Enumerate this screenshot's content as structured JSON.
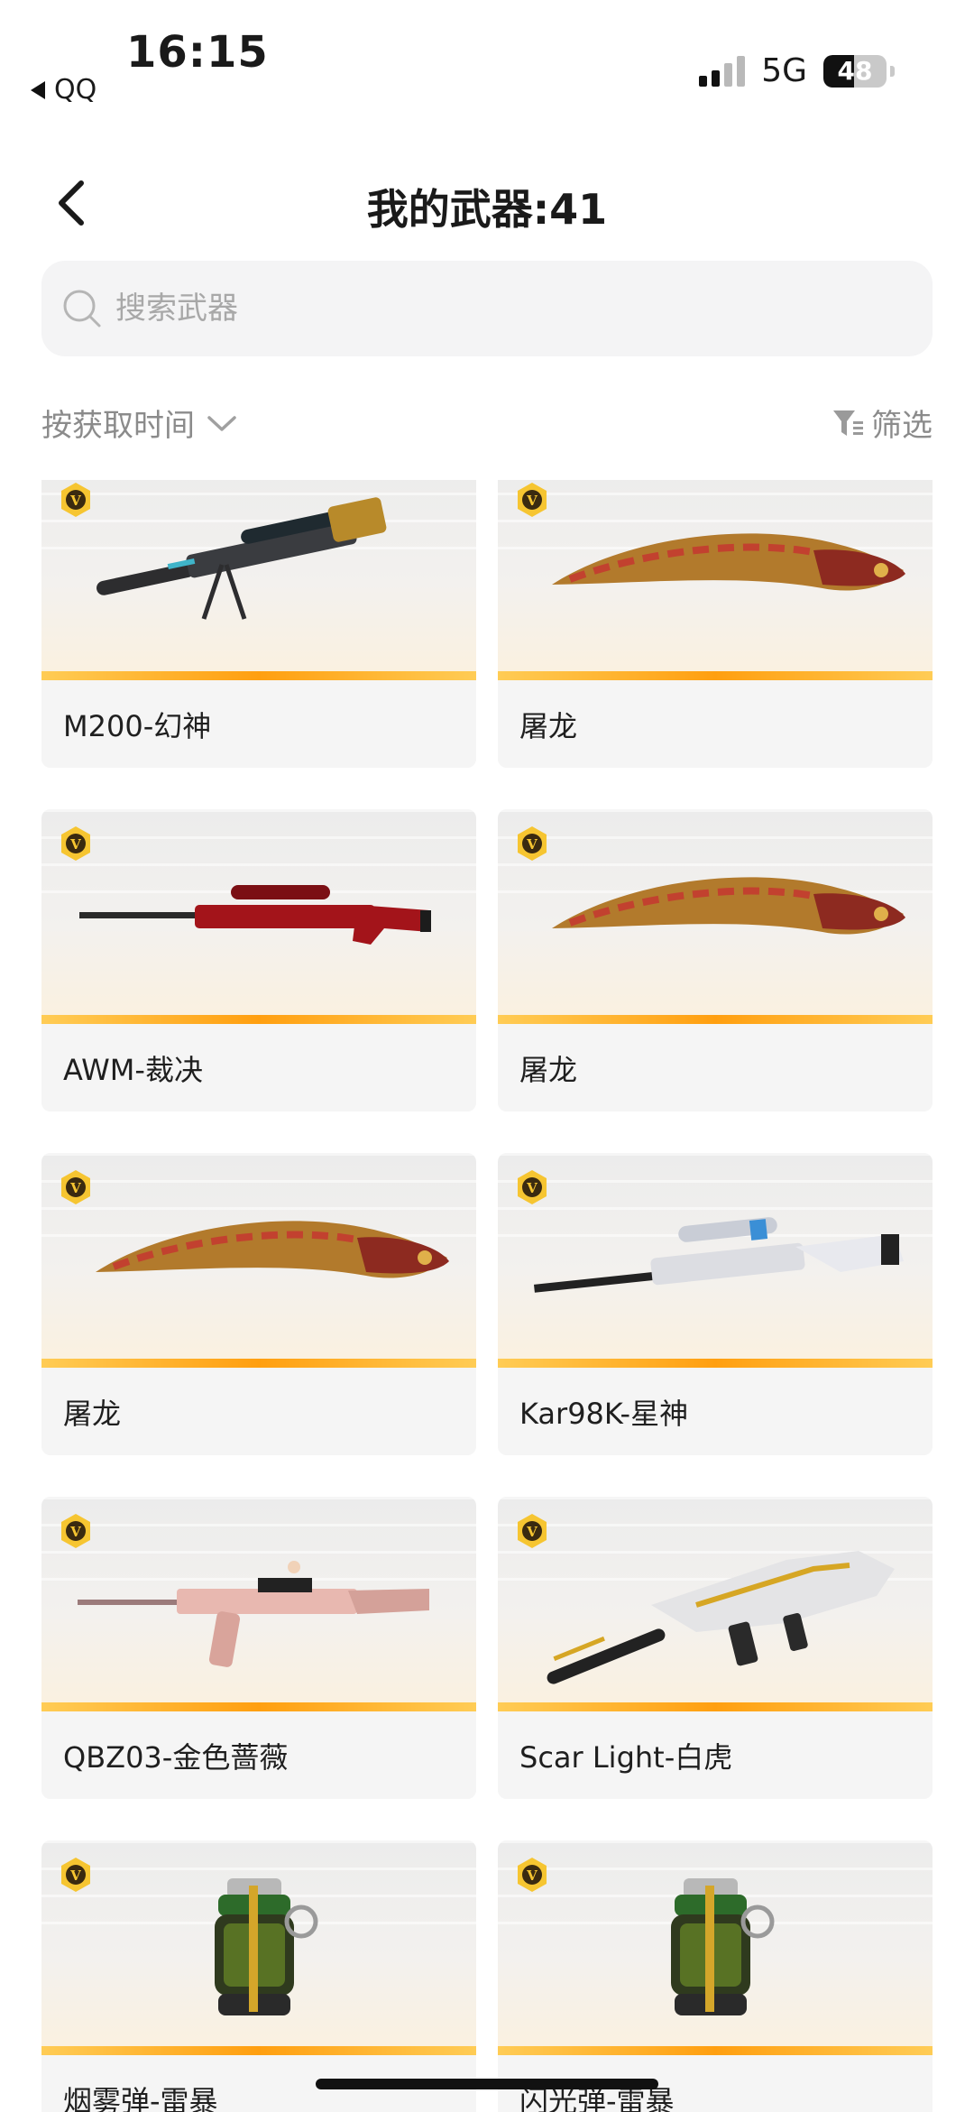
{
  "status_bar": {
    "time": "16:15",
    "back_app": "QQ",
    "network": "5G",
    "battery": "48",
    "battery_level": 0.48
  },
  "header": {
    "title": "我的武器:41",
    "back_icon": "chevron-left-icon"
  },
  "search": {
    "placeholder": "搜索武器",
    "value": "",
    "icon": "search-icon"
  },
  "toolbar": {
    "sort_label": "按获取时间",
    "sort_icon": "chevron-down-icon",
    "filter_label": "筛选",
    "filter_icon": "filter-icon"
  },
  "colors": {
    "accent": "#ff9f10",
    "vip_badge": "#f6c531"
  },
  "weapons": [
    {
      "name": "M200-幻神",
      "icon": "sniper-rifle-icon",
      "type": "sniper"
    },
    {
      "name": "屠龙",
      "icon": "dragon-knife-icon",
      "type": "knife"
    },
    {
      "name": "AWM-裁决",
      "icon": "sniper-rifle-icon",
      "type": "awm"
    },
    {
      "name": "屠龙",
      "icon": "dragon-knife-icon",
      "type": "knife"
    },
    {
      "name": "屠龙",
      "icon": "dragon-knife-icon",
      "type": "knife"
    },
    {
      "name": "Kar98K-星神",
      "icon": "bolt-rifle-icon",
      "type": "kar"
    },
    {
      "name": "QBZ03-金色蔷薇",
      "icon": "assault-rifle-icon",
      "type": "qbz"
    },
    {
      "name": "Scar Light-白虎",
      "icon": "assault-rifle-icon",
      "type": "scar"
    },
    {
      "name": "烟雾弹-雷暴",
      "icon": "grenade-icon",
      "type": "grenade"
    },
    {
      "name": "闪光弹-雷暴",
      "icon": "grenade-icon",
      "type": "grenade"
    }
  ]
}
